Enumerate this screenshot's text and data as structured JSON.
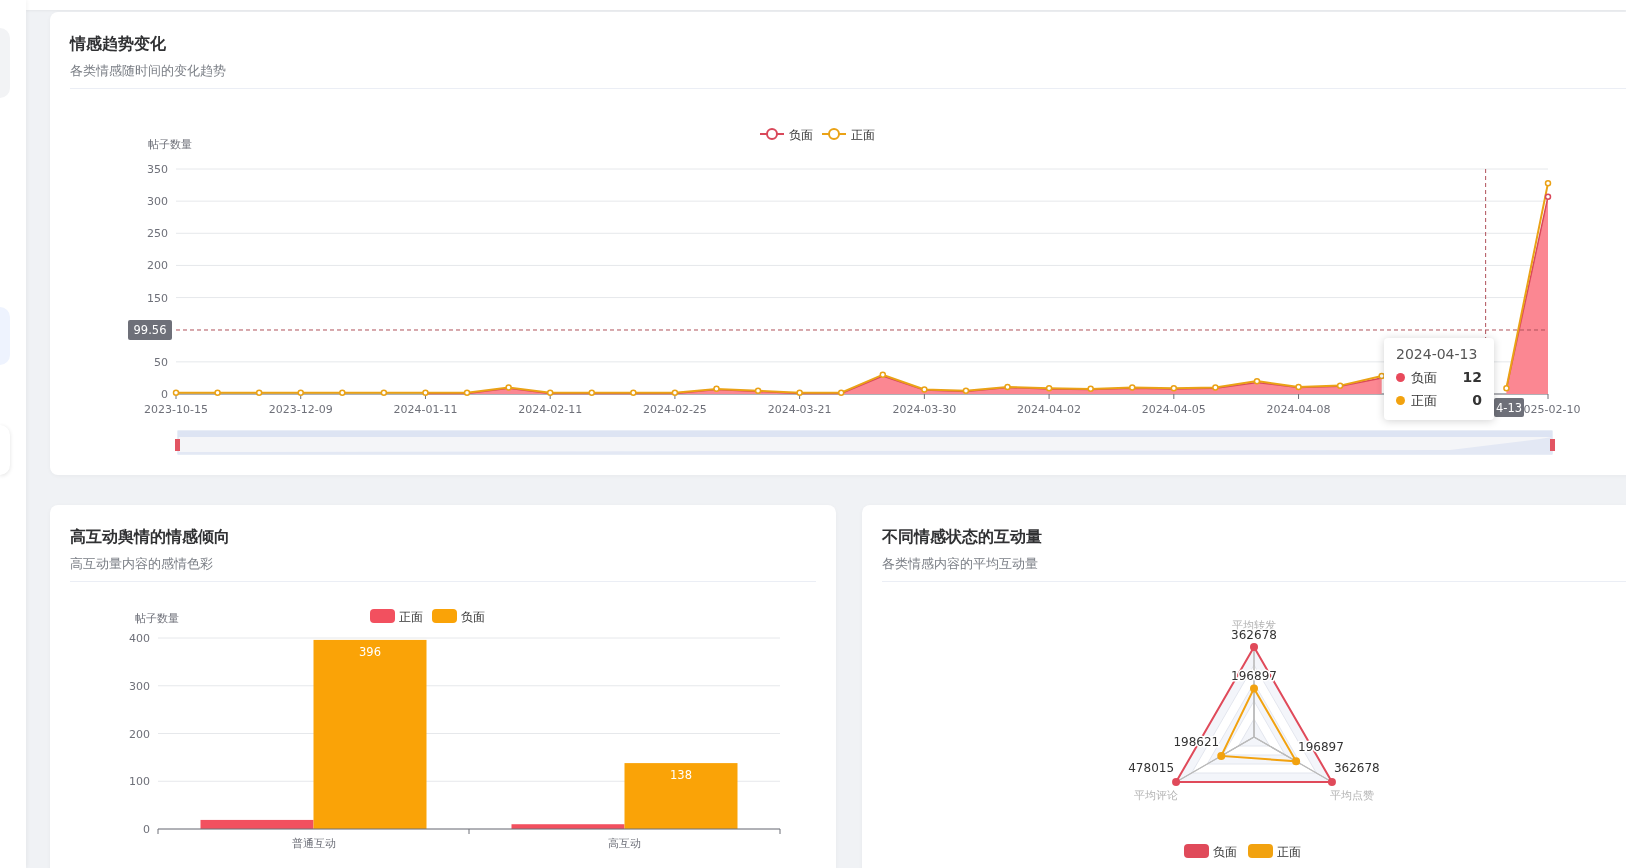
{
  "trend": {
    "title": "情感趋势变化",
    "subtitle": "各类情感随时间的变化趋势",
    "chart_data": {
      "type": "line",
      "stacked": false,
      "grid": true,
      "legend": true,
      "ylabel": "帖子数量",
      "ylim": [
        0,
        350
      ],
      "yticks": [
        0,
        50,
        150,
        200,
        250,
        300,
        350
      ],
      "ref_lines": [
        {
          "axis": "y",
          "value": 99.56,
          "label": "99.56"
        }
      ],
      "categories": [
        "2023-10-15",
        null,
        null,
        "2023-12-09",
        null,
        null,
        "2024-01-11",
        null,
        null,
        "2024-02-11",
        null,
        null,
        "2024-02-25",
        null,
        null,
        "2024-03-21",
        null,
        null,
        "2024-03-30",
        null,
        null,
        "2024-04-02",
        null,
        null,
        "2024-04-05",
        null,
        null,
        "2024-04-08",
        null,
        null,
        null,
        null,
        null,
        "025-02-10"
      ],
      "series": [
        {
          "name": "负面",
          "type": "area",
          "color": "#d9485a",
          "values": [
            null,
            null,
            null,
            null,
            null,
            null,
            1,
            1,
            9,
            1,
            1,
            1,
            1,
            7,
            4,
            1,
            1,
            28,
            6,
            4,
            10,
            8,
            7,
            9,
            8,
            9,
            18,
            10,
            12,
            25,
            null,
            null,
            8,
            307
          ]
        },
        {
          "name": "正面",
          "type": "line",
          "marker": true,
          "color": "#eaa216",
          "values": [
            2,
            2,
            2,
            2,
            2,
            2,
            2,
            2,
            10,
            2,
            2,
            2,
            2,
            8,
            5,
            2,
            2,
            30,
            7,
            5,
            11,
            9,
            8,
            10,
            9,
            10,
            20,
            11,
            13,
            28,
            null,
            null,
            9,
            328
          ]
        }
      ]
    },
    "axis_pointer": {
      "x_label": "4-13"
    },
    "tooltip": {
      "title": "2024-04-13",
      "rows": [
        {
          "name": "负面",
          "value": "12",
          "color": "#e8495b"
        },
        {
          "name": "正面",
          "value": "0",
          "color": "#f2a20f"
        }
      ]
    }
  },
  "interaction": {
    "title": "高互动舆情的情感倾向",
    "subtitle": "高互动量内容的感情色彩",
    "chart_data": {
      "type": "bar",
      "ylabel": "帖子数量",
      "categories": [
        "普通互动",
        "高互动"
      ],
      "ylim": [
        0,
        400
      ],
      "yticks": [
        0,
        100,
        200,
        300,
        400
      ],
      "grid": true,
      "legend": true,
      "value_labels": [
        [
          null,
          null
        ],
        [
          "396",
          "138"
        ]
      ],
      "series": [
        {
          "name": "正面",
          "color": "#f2505f",
          "values": [
            19,
            10
          ]
        },
        {
          "name": "负面",
          "color": "#faa307",
          "values": [
            396,
            138
          ]
        }
      ]
    }
  },
  "engagement": {
    "title": "不同情感状态的互动量",
    "subtitle": "各类情感内容的平均互动量",
    "radar": {
      "indicators": [
        {
          "name": "平均转发"
        },
        {
          "name": "平均点赞"
        },
        {
          "name": "平均评论"
        }
      ],
      "series": [
        {
          "name": "负面",
          "color": "#e04a5a",
          "points": [
            {
              "value": "362678",
              "level": 1
            },
            {
              "value": "362678",
              "level": 1
            },
            {
              "value": "478015",
              "level": 1
            }
          ]
        },
        {
          "name": "正面",
          "color": "#f2a20f",
          "points": [
            {
              "value": "196897",
              "level": 0.54
            },
            {
              "value": "196897",
              "level": 0.54
            },
            {
              "value": "198621",
              "level": 0.42
            }
          ]
        }
      ]
    }
  }
}
